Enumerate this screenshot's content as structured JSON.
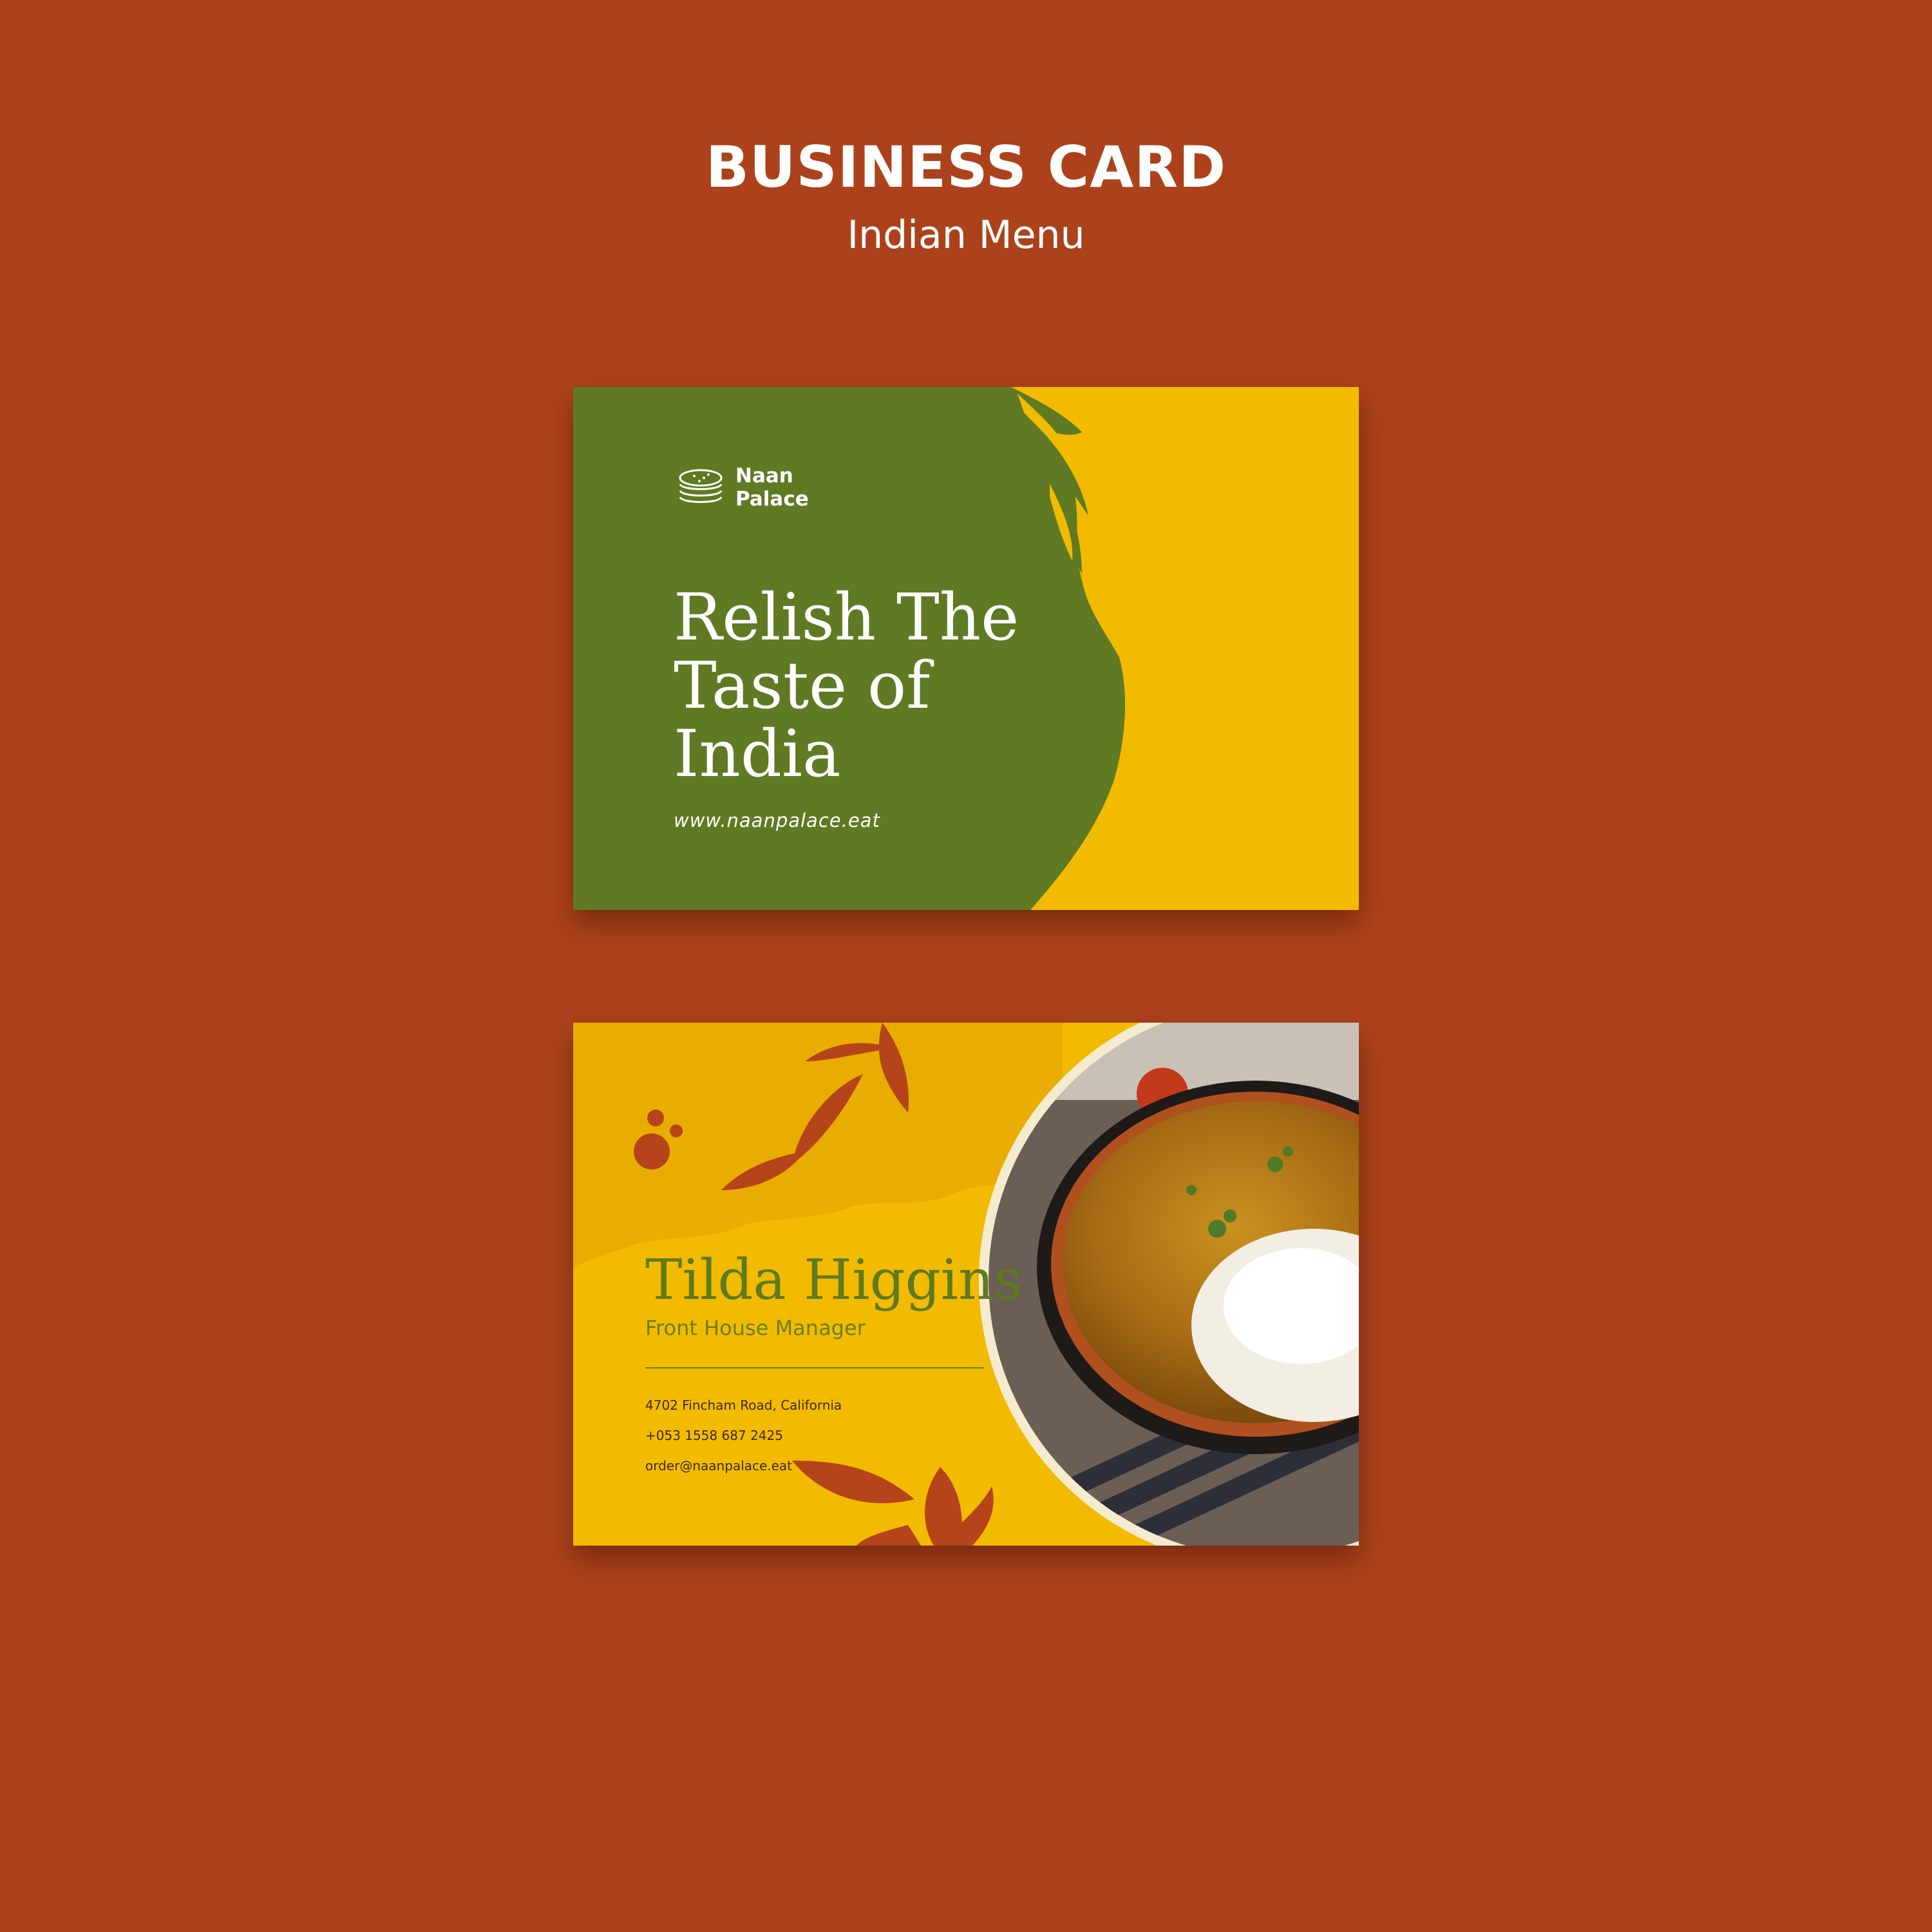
{
  "header": {
    "title": "BUSINESS CARD",
    "subtitle": "Indian Menu"
  },
  "front_card": {
    "logo_line1": "Naan",
    "logo_line2": "Palace",
    "logo_icon": "naan-stack-icon",
    "tagline_line1": "Relish The",
    "tagline_line2": "Taste of India",
    "website": "www.naanpalace.eat"
  },
  "back_card": {
    "name": "Tilda Higgins",
    "role": "Front House Manager",
    "address": "4702 Fincham Road, California",
    "phone": "+053 1558 687 2425",
    "email": "order@naanpalace.eat",
    "photo": "dal-and-rice-bowl-photo"
  },
  "colors": {
    "background": "#ac421b",
    "green": "#5f7a23",
    "yellow": "#f2bb00",
    "leaf": "#b5441a"
  }
}
